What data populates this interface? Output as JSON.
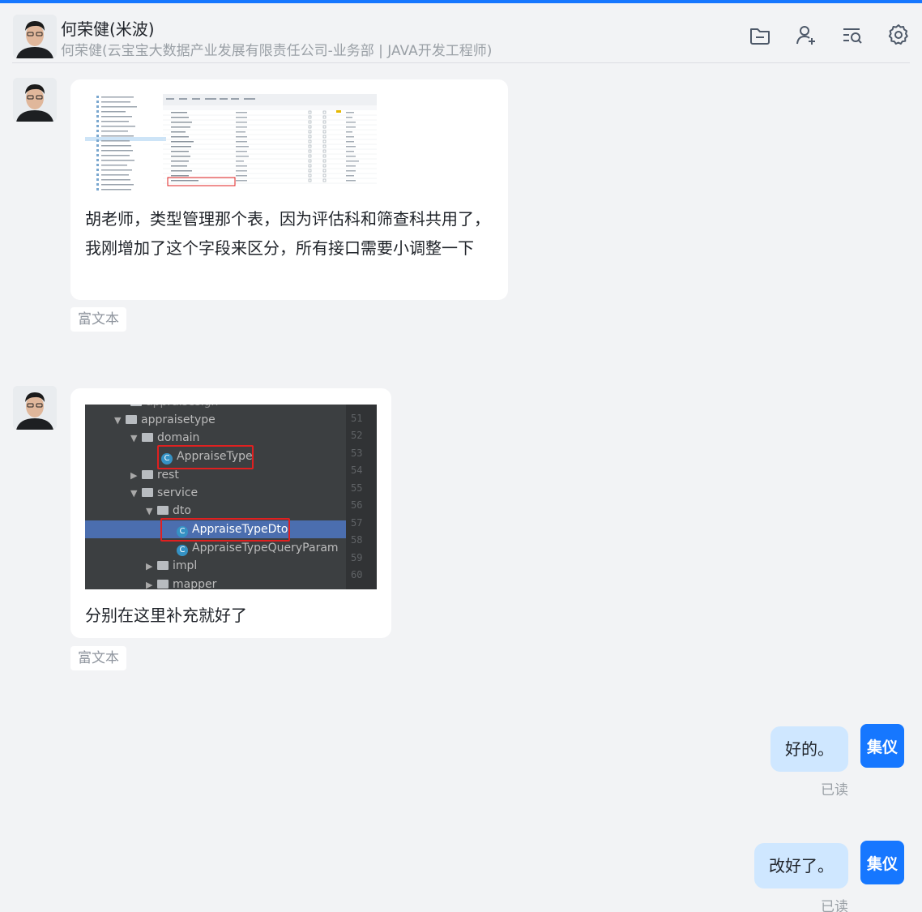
{
  "header": {
    "title": "何荣健(米波)",
    "subtitle": "何荣健(云宝宝大数据产业发展有限责任公司-业务部 | JAVA开发工程师)",
    "icons": [
      "folder-icon",
      "add-user-icon",
      "search-list-icon",
      "settings-icon"
    ]
  },
  "messages": [
    {
      "text": "胡老师，类型管理那个表，因为评估科和筛查科共用了，我刚增加了这个字段来区分，所有接口需要小调整一下",
      "tag": "富文本"
    },
    {
      "text": "分别在这里补充就好了",
      "tag": "富文本",
      "ide": {
        "rows": [
          "appraisesign",
          "appraisetype",
          "domain",
          "AppraiseType",
          "rest",
          "service",
          "dto",
          "AppraiseTypeDto",
          "AppraiseTypeQueryParam",
          "impl",
          "mapper"
        ],
        "line_numbers": [
          "51",
          "52",
          "53",
          "54",
          "55",
          "56",
          "57",
          "58",
          "59",
          "60"
        ]
      }
    }
  ],
  "replies": [
    {
      "text": "好的。",
      "avatar": "集仪",
      "status": "已读"
    },
    {
      "text": "改好了。",
      "avatar": "集仪",
      "status": "已读"
    }
  ],
  "colors": {
    "accent": "#1677ff",
    "out_bubble": "#cfe7ff",
    "ide_selection": "#4b6eaf",
    "highlight_box": "#e02020"
  }
}
